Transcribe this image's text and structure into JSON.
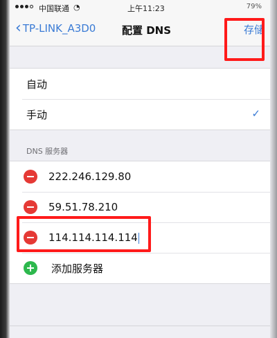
{
  "status_bar": {
    "carrier": "中国联通",
    "wifi_icon": "wifi-icon",
    "time": "上午11:23",
    "battery_text": "79%"
  },
  "nav": {
    "back_label": "TP-LINK_A3D0",
    "back_icon": "chevron-left-icon",
    "title": "配置 DNS",
    "save_label": "存储"
  },
  "mode": {
    "items": [
      {
        "label": "自动",
        "selected": false
      },
      {
        "label": "手动",
        "selected": true
      }
    ],
    "checkmark": "✓"
  },
  "dns": {
    "section_header": "DNS 服务器",
    "servers": [
      "222.246.129.80",
      "59.51.78.210",
      "114.114.114.114"
    ],
    "add_label": "添加服务器"
  },
  "colors": {
    "accent": "#3a7bd5",
    "delete": "#e53935",
    "add": "#2db84d",
    "highlight": "#ff1a1a",
    "background": "#efeff4"
  }
}
